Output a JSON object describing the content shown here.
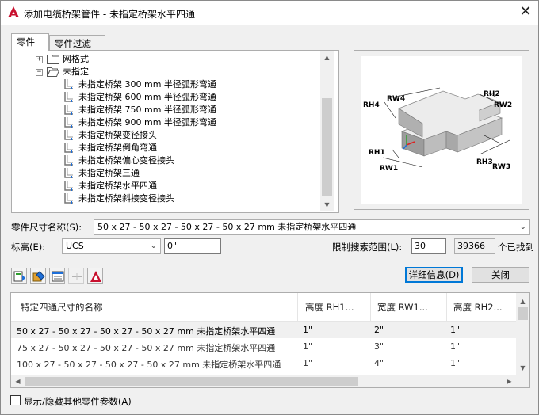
{
  "window": {
    "title": "添加电缆桥架管件 - 未指定桥架水平四通",
    "close_glyph": "✕"
  },
  "tabs": [
    {
      "label": "零件"
    },
    {
      "label": "零件过滤器"
    }
  ],
  "tree": {
    "items": [
      {
        "label": "网格式",
        "type": "folder",
        "expander": "+"
      },
      {
        "label": "未指定",
        "type": "folder-open",
        "expander": "−"
      },
      {
        "label": "未指定桥架 300 mm 半径弧形弯通",
        "type": "part"
      },
      {
        "label": "未指定桥架 600 mm 半径弧形弯通",
        "type": "part"
      },
      {
        "label": "未指定桥架 750 mm 半径弧形弯通",
        "type": "part"
      },
      {
        "label": "未指定桥架 900 mm 半径弧形弯通",
        "type": "part"
      },
      {
        "label": "未指定桥架变径接头",
        "type": "part"
      },
      {
        "label": "未指定桥架倒角弯通",
        "type": "part"
      },
      {
        "label": "未指定桥架偏心变径接头",
        "type": "part"
      },
      {
        "label": "未指定桥架三通",
        "type": "part"
      },
      {
        "label": "未指定桥架水平四通",
        "type": "part"
      },
      {
        "label": "未指定桥架斜接变径接头",
        "type": "part"
      }
    ]
  },
  "preview": {
    "labels": {
      "rh1": "RH1",
      "rh2": "RH2",
      "rh3": "RH3",
      "rh4": "RH4",
      "rw1": "RW1",
      "rw2": "RW2",
      "rw3": "RW3",
      "rw4": "RW4"
    }
  },
  "form": {
    "size_name_label": "零件尺寸名称(S):",
    "size_name_value": "50 x 27 - 50 x 27 - 50 x 27 - 50 x 27 mm 未指定桥架水平四通",
    "elevation_label": "标高(E):",
    "elevation_combo": "UCS",
    "elevation_value": "0\"",
    "search_limit_label": "限制搜索范围(L):",
    "search_limit_value": "30",
    "found_count": "39366",
    "found_suffix": "个已找到"
  },
  "buttons": {
    "details": "详细信息(D)",
    "close": "关闭"
  },
  "grid": {
    "columns": [
      "特定四通尺寸的名称",
      "高度 RH1...",
      "宽度 RW1...",
      "高度 RH2..."
    ],
    "rows": [
      [
        "50 x 27 - 50 x 27 - 50 x 27 - 50 x 27 mm 未指定桥架水平四通",
        "1\"",
        "2\"",
        "1\""
      ],
      [
        "75 x 27 - 50 x 27 - 50 x 27 - 50 x 27 mm 未指定桥架水平四通",
        "1\"",
        "3\"",
        "1\""
      ],
      [
        "100 x 27 - 50 x 27 - 50 x 27 - 50 x 27 mm 未指定桥架水平四通",
        "1\"",
        "4\"",
        "1\""
      ]
    ]
  },
  "checkbox": {
    "label": "显示/隐藏其他零件参数(A)",
    "checked": false
  },
  "colors": {
    "accent": "#0078d7",
    "logo_red": "#c8102e"
  }
}
